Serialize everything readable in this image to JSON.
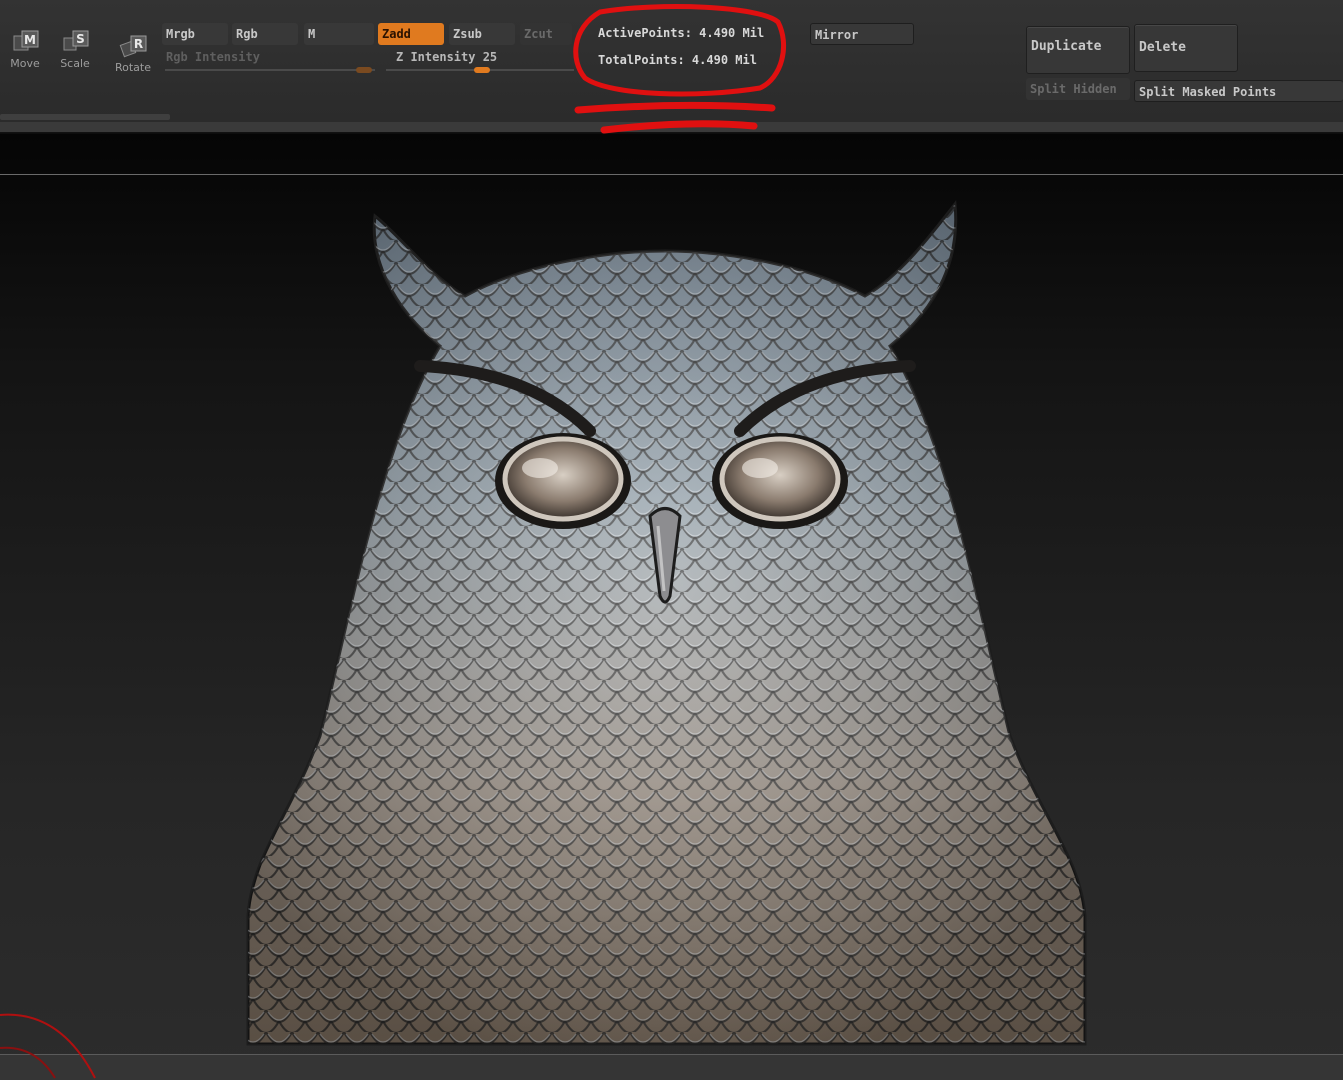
{
  "tools": {
    "move": {
      "letter": "M",
      "label": "Move"
    },
    "scale": {
      "letter": "S",
      "label": "Scale"
    },
    "rotate": {
      "letter": "R",
      "label": "Rotate"
    }
  },
  "draw_modes": {
    "mrgb": "Mrgb",
    "rgb": "Rgb",
    "m": "M",
    "zadd": "Zadd",
    "zsub": "Zsub",
    "zcut": "Zcut"
  },
  "sliders": {
    "rgb_intensity": {
      "label": "Rgb Intensity"
    },
    "z_intensity": {
      "label": "Z Intensity 25",
      "value": 25
    }
  },
  "stats": {
    "active_points": "ActivePoints: 4.490  Mil",
    "total_points": "TotalPoints: 4.490  Mil"
  },
  "subtool": {
    "mirror": "Mirror",
    "duplicate": "Duplicate",
    "delete": "Delete",
    "split_hidden": "Split Hidden",
    "split_masked_points": "Split Masked Points"
  },
  "colors": {
    "accent": "#e07a1f",
    "annotation": "#e01010"
  },
  "icons": [
    "move-icon",
    "scale-icon",
    "rotate-icon"
  ]
}
